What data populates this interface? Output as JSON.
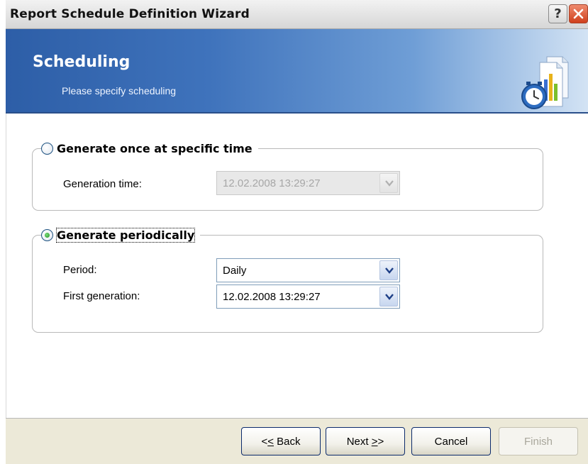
{
  "window": {
    "title": "Report Schedule Definition Wizard",
    "help_glyph": "?",
    "close_icon": "close-icon"
  },
  "header": {
    "title": "Scheduling",
    "subtitle": "Please specify scheduling",
    "icon": "report-schedule-icon"
  },
  "once": {
    "label": "Generate once at specific time",
    "selected": false,
    "generation_time_label": "Generation time:",
    "generation_time_value": "12.02.2008 13:29:27",
    "enabled": false
  },
  "periodic": {
    "label": "Generate periodically",
    "selected": true,
    "period_label": "Period:",
    "period_value": "Daily",
    "first_generation_label": "First generation:",
    "first_generation_value": "12.02.2008 13:29:27"
  },
  "buttons": {
    "back": {
      "prefix": "<",
      "mnemonic": "<",
      "rest": " Back"
    },
    "next": {
      "prefix": "Next ",
      "mnemonic": ">",
      "rest": ">"
    },
    "cancel": "Cancel",
    "finish": "Finish"
  },
  "colors": {
    "banner_start": "#2d5ea7",
    "banner_end": "#d3e3f4",
    "radio_dot": "#1f8a1f",
    "close_button": "#cf3f1c"
  }
}
